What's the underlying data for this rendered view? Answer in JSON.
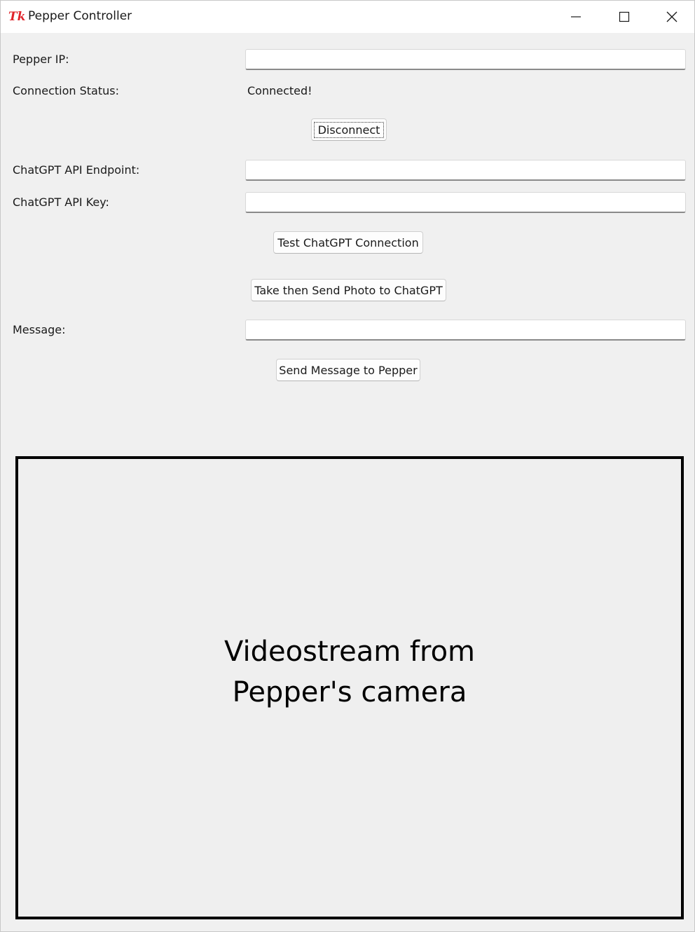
{
  "window": {
    "title": "Pepper Controller",
    "icon": "tk-feather-icon"
  },
  "controls": {
    "minimize_icon": "minimize-icon",
    "maximize_icon": "maximize-icon",
    "close_icon": "close-icon"
  },
  "form": {
    "pepper_ip_label": "Pepper IP:",
    "pepper_ip_value": "",
    "connection_status_label": "Connection Status:",
    "connection_status_value": "Connected!",
    "disconnect_label": "Disconnect",
    "api_endpoint_label": "ChatGPT API Endpoint:",
    "api_endpoint_value": "",
    "api_key_label": "ChatGPT API Key:",
    "api_key_value": "",
    "test_connection_label": "Test ChatGPT Connection",
    "send_photo_label": "Take then Send Photo to ChatGPT",
    "message_label": "Message:",
    "message_value": "",
    "send_message_label": "Send Message to Pepper"
  },
  "video": {
    "line1": "Videostream from",
    "line2": "Pepper's camera"
  },
  "colors": {
    "background": "#f0f0f0",
    "titlebar": "#ffffff",
    "tk_icon": "#e0242b"
  }
}
